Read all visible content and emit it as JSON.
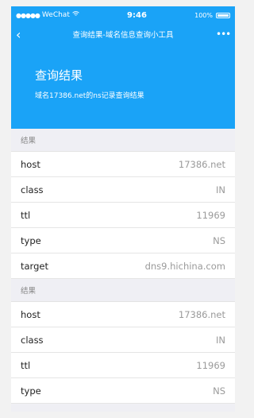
{
  "status_bar": {
    "signal": "●●●●●",
    "carrier": "WeChat",
    "wifi": "wifi-icon",
    "time": "9:46",
    "battery_pct": "100%"
  },
  "nav": {
    "title": "查询结果-域名信息查询小工具",
    "back_icon": "back-chevron-icon",
    "more_icon": "more-dots-icon"
  },
  "hero": {
    "title": "查询结果",
    "subtitle": "域名17386.net的ns记录查询结果"
  },
  "sections": [
    {
      "header": "结果",
      "rows": [
        {
          "key": "host",
          "value": "17386.net"
        },
        {
          "key": "class",
          "value": "IN"
        },
        {
          "key": "ttl",
          "value": "11969"
        },
        {
          "key": "type",
          "value": "NS"
        },
        {
          "key": "target",
          "value": "dns9.hichina.com"
        }
      ]
    },
    {
      "header": "结果",
      "rows": [
        {
          "key": "host",
          "value": "17386.net"
        },
        {
          "key": "class",
          "value": "IN"
        },
        {
          "key": "ttl",
          "value": "11969"
        },
        {
          "key": "type",
          "value": "NS"
        }
      ]
    }
  ],
  "colors": {
    "accent": "#1aa3f7",
    "background": "#efeff4"
  }
}
